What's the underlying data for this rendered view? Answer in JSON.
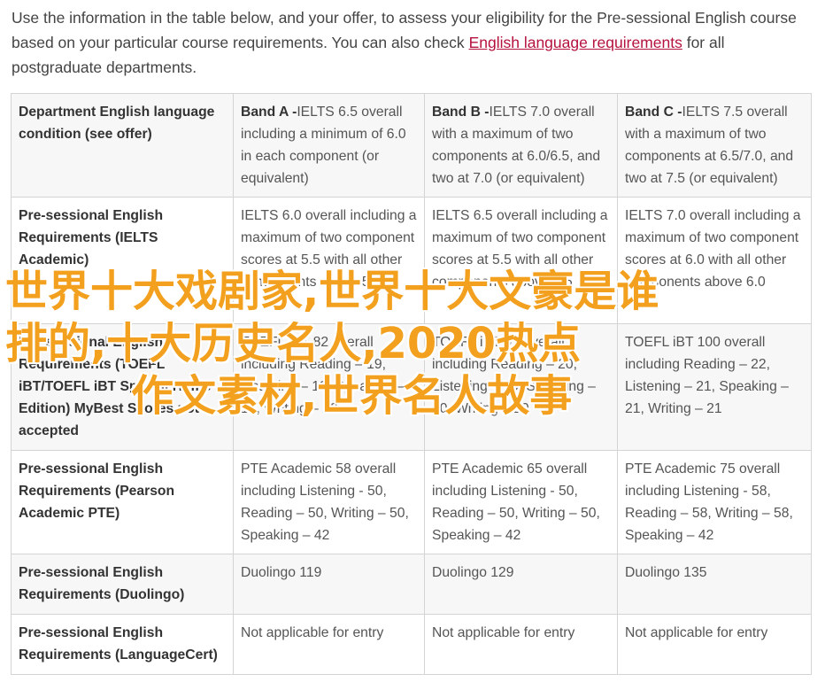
{
  "intro": {
    "text_before": "Use the information in the table below, and your offer, to assess your eligibility for the Pre-sessional English course based on your particular course requirements. You can also check ",
    "link_text": "English language requirements",
    "text_after": " for all postgraduate departments."
  },
  "table": {
    "header": {
      "col0": "Department English language condition (see offer)",
      "bands": [
        {
          "label": "Band A -",
          "text": "IELTS 6.5 overall including a minimum of 6.0 in each component (or equivalent)"
        },
        {
          "label": "Band B -",
          "text": "IELTS 7.0 overall with a maximum of two components at 6.0/6.5, and two at 7.0 (or equivalent)"
        },
        {
          "label": "Band C -",
          "text": "IELTS 7.5 overall with a maximum of two components at 6.5/7.0, and two at 7.5 (or equivalent)"
        }
      ]
    },
    "rows": [
      {
        "label": "Pre-sessional English Requirements (IELTS Academic)",
        "cells": [
          "IELTS 6.0 overall including a maximum of two component scores at 5.5 with all other components above 5.0",
          "IELTS 6.5 overall including a maximum of two component scores at 5.5 with all other components above 5.5",
          "IELTS 7.0 overall including a maximum of two component scores at 6.0 with all other components above 6.0"
        ]
      },
      {
        "label": "Pre-sessional English Requirements (TOEFL iBT/TOEFL iBT Special Home Edition) MyBest Scores not accepted",
        "cells": [
          "TOEFL iBT 82 overall including Reading – 19, Listening – 19, Speaking – 19, Writing – 20",
          "TOEFL iBT 92 overall including Reading – 20, Listening – 20, Speaking – 20, Writing – 20",
          "TOEFL iBT 100 overall including Reading – 22, Listening – 21, Speaking – 21, Writing – 21"
        ]
      },
      {
        "label": "Pre-sessional English Requirements (Pearson Academic PTE)",
        "cells": [
          "PTE Academic 58 overall including Listening - 50, Reading – 50, Writing – 50, Speaking – 42",
          "PTE Academic 65 overall including Listening - 50, Reading – 50, Writing – 50, Speaking – 42",
          "PTE Academic 75 overall including Listening - 58, Reading – 58, Writing – 58, Speaking – 42"
        ]
      },
      {
        "label": "Pre-sessional English Requirements (Duolingo)",
        "cells": [
          "Duolingo 119",
          "Duolingo 129",
          "Duolingo 135"
        ]
      },
      {
        "label": "Pre-sessional English Requirements (LanguageCert)",
        "cells": [
          "Not applicable for entry",
          "Not applicable for entry",
          "Not applicable for entry"
        ]
      }
    ]
  },
  "watermark": {
    "lines": [
      "世界十大戏剧家,世界十大文豪是谁",
      "排的,十大历史名人,2020热点",
      "作文素材,世界名人故事"
    ],
    "color": "#f2a01e"
  },
  "colors": {
    "link": "#b5123e",
    "text": "#444444",
    "border": "#d4d4d4"
  }
}
